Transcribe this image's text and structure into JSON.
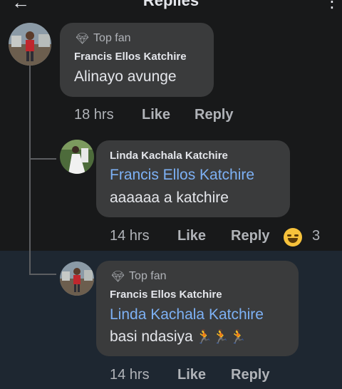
{
  "header": {
    "title": "Replies",
    "back_icon": "back-arrow-icon",
    "more_icon": "more-options-icon"
  },
  "comments": [
    {
      "badge": "Top fan",
      "badge_icon": "diamond-icon",
      "author": "Francis Ellos Katchire",
      "text": "Alinayo avunge",
      "time": "18 hrs",
      "like": "Like",
      "reply": "Reply"
    },
    {
      "author": "Linda Kachala Katchire",
      "mention": "Francis Ellos Katchire",
      "text": "aaaaaa a katchire",
      "time": "14 hrs",
      "like": "Like",
      "reply": "Reply",
      "reaction_icon": "laughing-emoji-icon",
      "reaction_count": "3"
    },
    {
      "badge": "Top fan",
      "badge_icon": "diamond-icon",
      "author": "Francis Ellos Katchire",
      "mention": "Linda Kachala Katchire",
      "text": "basi ndasiya",
      "emoji": "🏃🏃🏃",
      "time": "14 hrs",
      "like": "Like",
      "reply": "Reply"
    }
  ],
  "colors": {
    "background": "#18191a",
    "bubble": "#3a3b3c",
    "highlight": "#1e2731",
    "mention": "#7db1f5",
    "meta": "#b0b3b8"
  }
}
